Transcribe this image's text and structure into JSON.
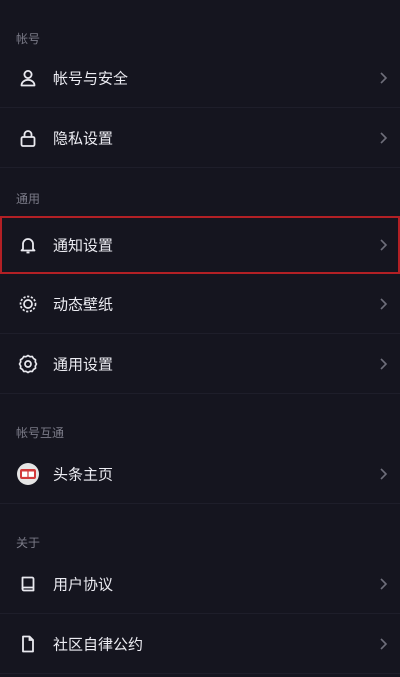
{
  "sections": [
    {
      "title": "帐号",
      "items": [
        {
          "label": "帐号与安全",
          "icon": "user-icon"
        },
        {
          "label": "隐私设置",
          "icon": "lock-icon"
        }
      ]
    },
    {
      "title": "通用",
      "items": [
        {
          "label": "通知设置",
          "icon": "bell-icon",
          "highlighted": true
        },
        {
          "label": "动态壁纸",
          "icon": "wallpaper-icon"
        },
        {
          "label": "通用设置",
          "icon": "gear-icon"
        }
      ]
    },
    {
      "title": "帐号互通",
      "items": [
        {
          "label": "头条主页",
          "icon": "toutiao-avatar-icon"
        }
      ]
    },
    {
      "title": "关于",
      "items": [
        {
          "label": "用户协议",
          "icon": "book-icon"
        },
        {
          "label": "社区自律公约",
          "icon": "document-icon"
        }
      ]
    }
  ],
  "colors": {
    "background": "#15151f",
    "highlight_border": "#b32025"
  }
}
